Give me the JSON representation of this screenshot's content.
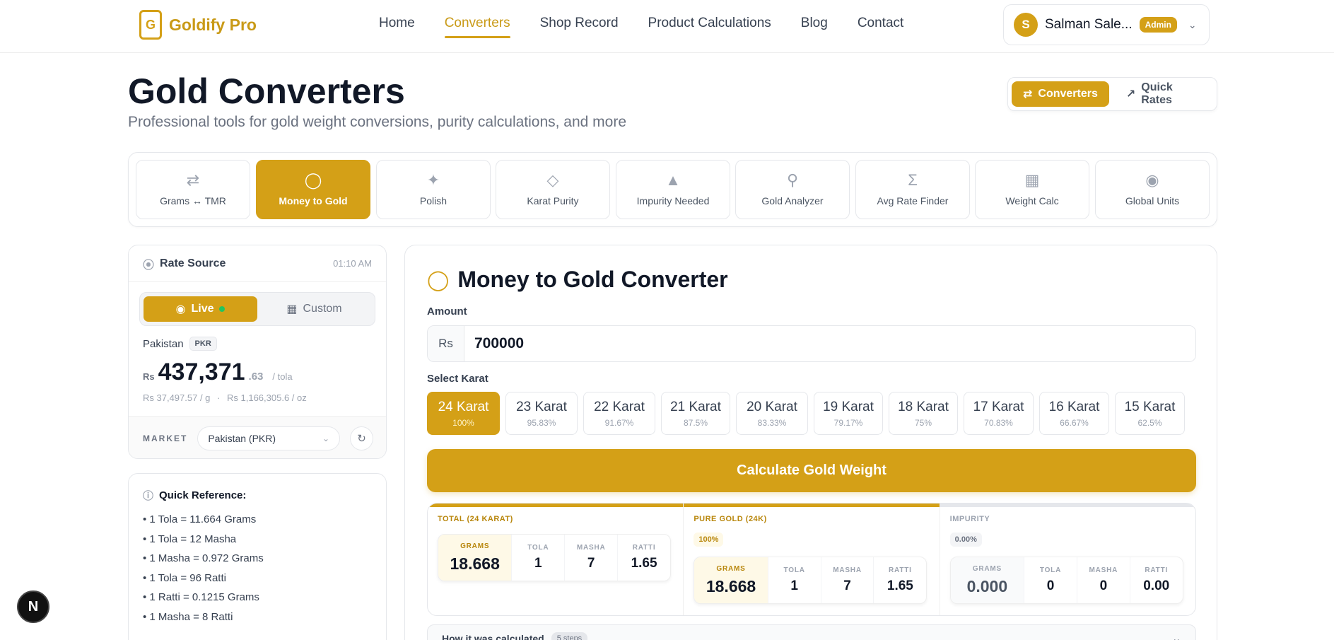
{
  "brand": {
    "name": "Goldify Pro",
    "logo_letter": "G"
  },
  "nav": {
    "items": [
      "Home",
      "Converters",
      "Shop Record",
      "Product Calculations",
      "Blog",
      "Contact"
    ],
    "active": "Converters"
  },
  "user": {
    "initial": "S",
    "name": "Salman Sale...",
    "role": "Admin"
  },
  "page": {
    "title": "Gold Converters",
    "subtitle": "Professional tools for gold weight conversions, purity calculations, and more"
  },
  "mode_switch": {
    "converters": "Converters",
    "quick_rates": "Quick Rates"
  },
  "tools": [
    {
      "label": "Grams ↔ TMR",
      "icon": "swap-icon"
    },
    {
      "label": "Money to Gold",
      "icon": "coins-icon",
      "active": true
    },
    {
      "label": "Polish",
      "icon": "sparkles-icon"
    },
    {
      "label": "Karat Purity",
      "icon": "gem-icon"
    },
    {
      "label": "Impurity Needed",
      "icon": "flask-icon"
    },
    {
      "label": "Gold Analyzer",
      "icon": "search-icon"
    },
    {
      "label": "Avg Rate Finder",
      "icon": "sigma-icon"
    },
    {
      "label": "Weight Calc",
      "icon": "calculator-icon"
    },
    {
      "label": "Global Units",
      "icon": "globe-icon"
    }
  ],
  "rate_source": {
    "label": "Rate Source",
    "time": "01:10 AM",
    "live_label": "Live",
    "custom_label": "Custom",
    "country": "Pakistan",
    "currency_tag": "PKR",
    "currency_symbol": "Rs",
    "price_main": "437,371",
    "price_decimal": ".63",
    "price_unit": "/ tola",
    "per_gram": "Rs 37,497.57 / g",
    "per_oz": "Rs 1,166,305.6 / oz",
    "market_label": "MARKET",
    "market_value": "Pakistan (PKR)"
  },
  "quick_reference": {
    "title": "Quick Reference:",
    "items": [
      "1 Tola = 11.664 Grams",
      "1 Tola = 12 Masha",
      "1 Masha = 0.972 Grams",
      "1 Tola = 96 Ratti",
      "1 Ratti = 0.1215 Grams",
      "1 Masha = 8 Ratti"
    ]
  },
  "converter": {
    "title": "Money to Gold Converter",
    "amount_label": "Amount",
    "currency": "Rs",
    "amount_value": "700000",
    "karat_label": "Select Karat",
    "karats": [
      {
        "label": "24 Karat",
        "pct": "100%",
        "active": true
      },
      {
        "label": "23 Karat",
        "pct": "95.83%"
      },
      {
        "label": "22 Karat",
        "pct": "91.67%"
      },
      {
        "label": "21 Karat",
        "pct": "87.5%"
      },
      {
        "label": "20 Karat",
        "pct": "83.33%"
      },
      {
        "label": "19 Karat",
        "pct": "79.17%"
      },
      {
        "label": "18 Karat",
        "pct": "75%"
      },
      {
        "label": "17 Karat",
        "pct": "70.83%"
      },
      {
        "label": "16 Karat",
        "pct": "66.67%"
      },
      {
        "label": "15 Karat",
        "pct": "62.5%"
      }
    ],
    "calculate_label": "Calculate Gold Weight",
    "unit_headers": [
      "GRAMS",
      "TOLA",
      "MASHA",
      "RATTI"
    ],
    "results": [
      {
        "title": "TOTAL (24 KARAT)",
        "pct": "",
        "values": [
          "18.668",
          "1",
          "7",
          "1.65"
        ]
      },
      {
        "title": "PURE GOLD (24K)",
        "pct": "100%",
        "values": [
          "18.668",
          "1",
          "7",
          "1.65"
        ]
      },
      {
        "title": "IMPURITY",
        "pct": "0.00%",
        "values": [
          "0.000",
          "0",
          "0",
          "0.00"
        ]
      }
    ],
    "how_label": "How it was calculated",
    "steps_label": "5 steps"
  },
  "floating_badge": "N",
  "colors": {
    "accent": "#d4a017",
    "accent_text": "#c99a17"
  }
}
